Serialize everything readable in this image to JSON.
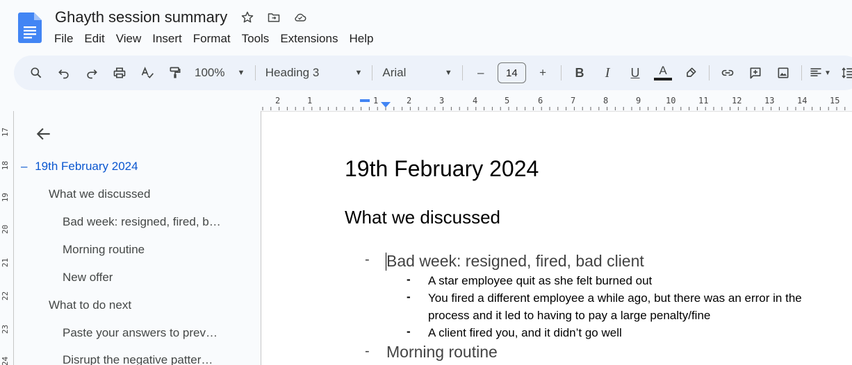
{
  "doc": {
    "title": "Ghayth session summary"
  },
  "menu": [
    "File",
    "Edit",
    "View",
    "Insert",
    "Format",
    "Tools",
    "Extensions",
    "Help"
  ],
  "toolbar": {
    "zoom": "100%",
    "style": "Heading 3",
    "font": "Arial",
    "font_size": "14",
    "minus": "–",
    "plus": "+",
    "bold": "B",
    "italic": "I",
    "underline": "U",
    "text_color_letter": "A"
  },
  "ruler": {
    "top_labels": [
      "2",
      "1",
      "1",
      "2",
      "3",
      "4",
      "5",
      "6",
      "7",
      "8",
      "9",
      "10",
      "11",
      "12",
      "13",
      "14",
      "15"
    ],
    "left_labels": [
      "17",
      "18",
      "19",
      "20",
      "21",
      "22",
      "23",
      "24"
    ]
  },
  "outline": {
    "items": [
      {
        "label": "19th February 2024",
        "prefix": "–"
      },
      {
        "label": "What we discussed"
      },
      {
        "label": "Bad week: resigned, fired, b…"
      },
      {
        "label": "Morning routine"
      },
      {
        "label": "New offer"
      },
      {
        "label": "What to do next"
      },
      {
        "label": "Paste your answers to prev…"
      },
      {
        "label": "Disrupt the negative patter…"
      }
    ]
  },
  "page": {
    "h1": "19th February 2024",
    "h2": "What we discussed",
    "h3_1": "Bad week: resigned, fired, bad client",
    "sub_1": "A star employee quit as she felt burned out",
    "sub_2a": "You fired a different employee a while ago, but there was an error in the",
    "sub_2b": "process and it led to having to pay a large penalty/fine",
    "sub_3": "A client fired you, and it didn’t go well",
    "h3_2": "Morning routine",
    "dash": "-"
  },
  "colors": {
    "accent": "#0b57d0",
    "toolbar_bg": "#edf2fa",
    "docs_blue": "#4285f4"
  }
}
